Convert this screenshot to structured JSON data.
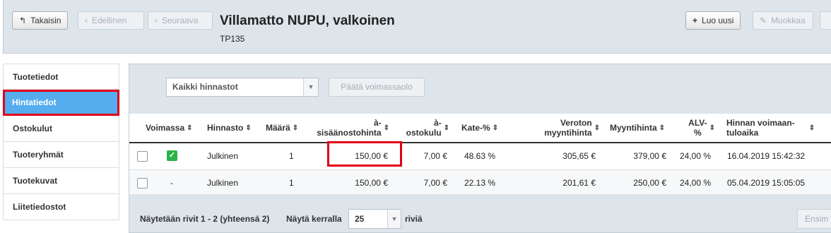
{
  "header": {
    "back_label": "Takaisin",
    "prev_label": "Edellinen",
    "next_label": "Seuraava",
    "title": "Villamatto NUPU, valkoinen",
    "code": "TP135",
    "new_label": "Luo uusi",
    "edit_label": "Muokkaa"
  },
  "sidebar": {
    "items": [
      {
        "label": "Tuotetiedot"
      },
      {
        "label": "Hintatiedot"
      },
      {
        "label": "Ostokulut"
      },
      {
        "label": "Tuoteryhmät"
      },
      {
        "label": "Tuotekuvat"
      },
      {
        "label": "Liitetiedostot"
      }
    ],
    "active_index": 1
  },
  "filter": {
    "pricelist_value": "Kaikki hinnastot",
    "end_validity_label": "Päätä voimassaolo"
  },
  "table": {
    "headers": {
      "voimassa": "Voimassa",
      "hinnasto": "Hinnasto",
      "maara": "Määrä",
      "sisaan_1": "à-",
      "sisaan_2": "sisäänostohinta",
      "osto_1": "à-",
      "osto_2": "ostokulu",
      "kate": "Kate-%",
      "veroton_1": "Veroton",
      "veroton_2": "myyntihinta",
      "myynti": "Myyntihinta",
      "alv_1": "ALV-",
      "alv_2": "%",
      "voim_1": "Hinnan voimaan-",
      "voim_2": "tuloaika"
    },
    "rows": [
      {
        "valid_mark": "",
        "pricelist": "Julkinen",
        "qty": "1",
        "purchase": "150,00 €",
        "cost": "7,00 €",
        "margin": "48.63 %",
        "net": "305,65 €",
        "gross": "379,00 €",
        "vat": "24,00 %",
        "from": "16.04.2019 15:42:32"
      },
      {
        "valid_mark": "-",
        "pricelist": "Julkinen",
        "qty": "1",
        "purchase": "150,00 €",
        "cost": "7,00 €",
        "margin": "22.13 %",
        "net": "201,61 €",
        "gross": "250,00 €",
        "vat": "24,00 %",
        "from": "05.04.2019 15:05:05"
      }
    ]
  },
  "footer": {
    "showing": "Näytetään rivit 1 - 2 (yhteensä 2)",
    "per_page_label": "Näytä kerralla",
    "per_page_value": "25",
    "rows_label": "riviä",
    "first_label": "Ensim"
  },
  "colors": {
    "accent_active": "#55acee",
    "highlight_red": "#e1001a",
    "check_green": "#2bb34a"
  }
}
